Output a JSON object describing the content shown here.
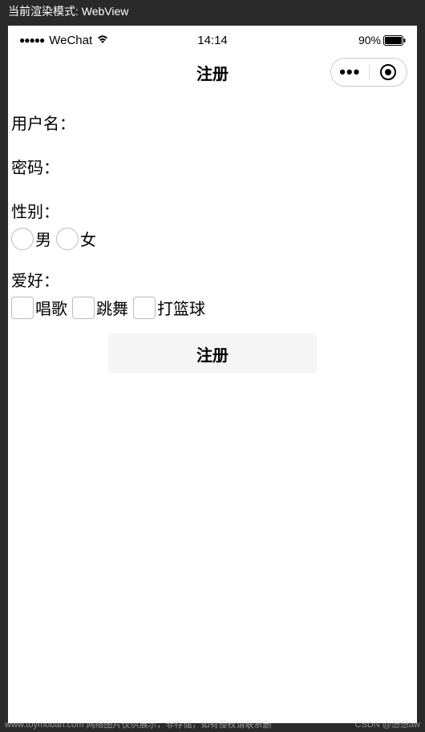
{
  "render_mode_label": "当前渲染模式: WebView",
  "status_bar": {
    "signal": "●●●●●",
    "carrier": "WeChat",
    "time": "14:14",
    "battery_pct": "90%"
  },
  "nav": {
    "title": "注册"
  },
  "form": {
    "username_label": "用户名：",
    "password_label": "密码：",
    "gender_label": "性别：",
    "gender_options": {
      "male": "男",
      "female": "女"
    },
    "hobbies_label": "爱好：",
    "hobby_options": {
      "sing": "唱歌",
      "dance": "跳舞",
      "basketball": "打篮球"
    },
    "submit_label": "注册"
  },
  "watermark": {
    "left": "www.toymoban.com 网络图片仅供展示，非存储，如有侵权请联系删",
    "right": "CSDN @想想aw"
  }
}
